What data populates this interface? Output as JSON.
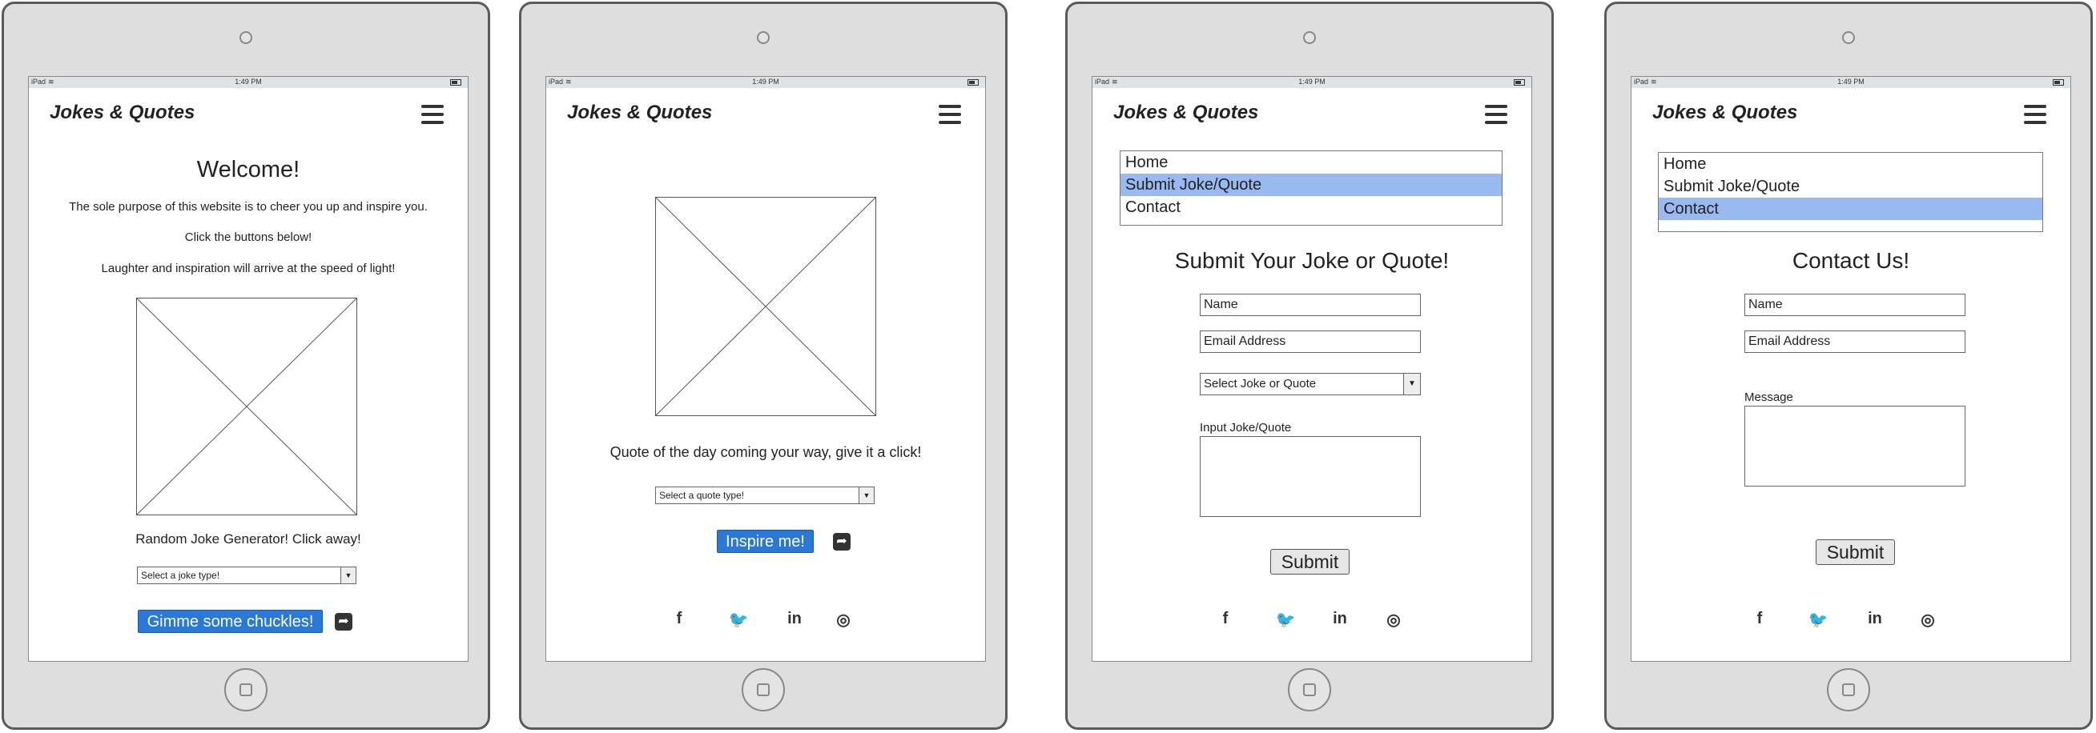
{
  "status_bar": {
    "device": "iPad",
    "time": "1:49 PM"
  },
  "brand": "Jokes & Quotes",
  "home": {
    "welcome": "Welcome!",
    "purpose": "The sole purpose of this website is to cheer you up and inspire you.",
    "click": "Click the buttons below!",
    "laughter": "Laughter and inspiration will arrive at the speed of light!",
    "joke_label": "Random Joke Generator! Click away!",
    "joke_select": "Select a joke type!",
    "joke_button": "Gimme some chuckles!"
  },
  "quote": {
    "label": "Quote of the day coming your way, give it a click!",
    "select": "Select a quote type!",
    "button": "Inspire me!"
  },
  "nav": {
    "items": [
      "Home",
      "Submit Joke/Quote",
      "Contact"
    ]
  },
  "submit_page": {
    "heading": "Submit Your Joke or Quote!",
    "name": "Name",
    "email": "Email Address",
    "select": "Select Joke or Quote",
    "input_label": "Input Joke/Quote",
    "button": "Submit"
  },
  "contact_page": {
    "heading": "Contact Us!",
    "name": "Name",
    "email": "Email Address",
    "message_label": "Message",
    "button": "Submit"
  },
  "social_icons": [
    "facebook-icon",
    "twitter-icon",
    "linkedin-icon",
    "instagram-icon"
  ],
  "colors": {
    "button_blue": "#2a78d7",
    "menu_highlight": "#9ab9f0"
  }
}
